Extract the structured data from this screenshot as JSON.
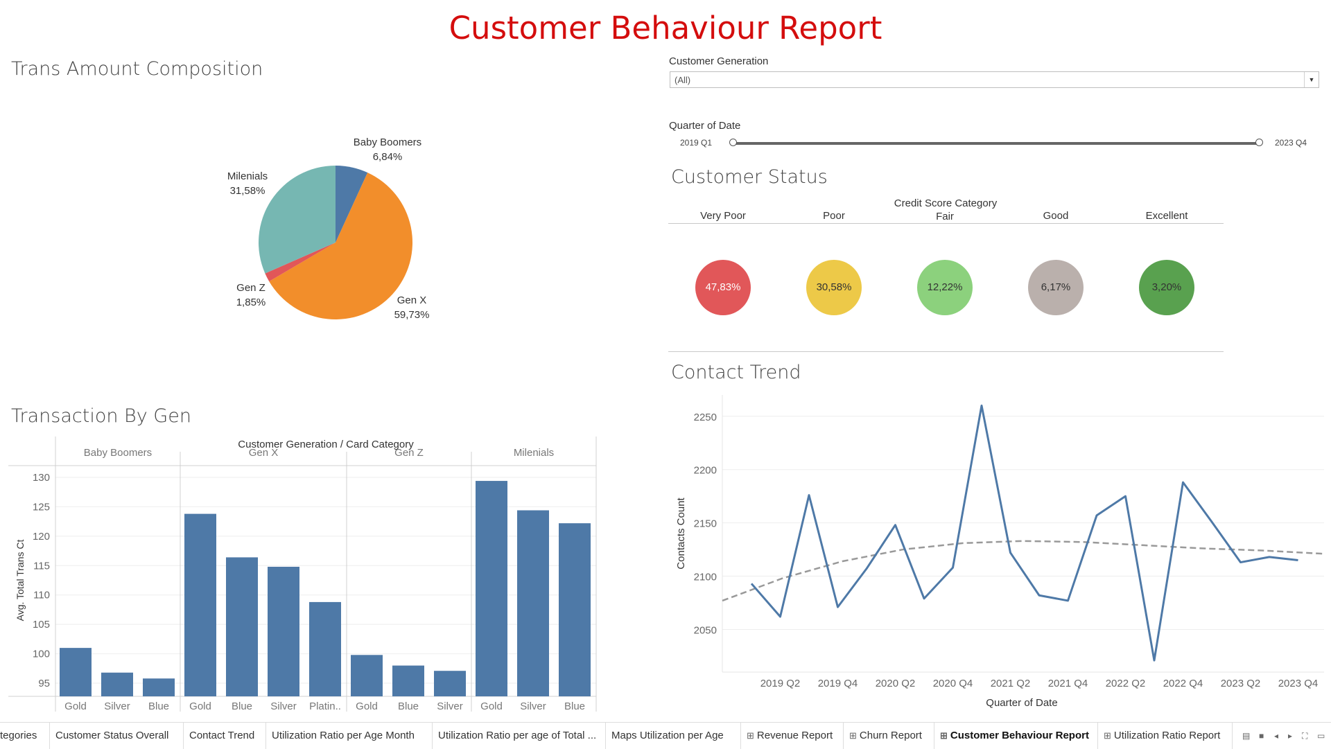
{
  "report_title": "Customer Behaviour Report",
  "pie_section": {
    "title": "Trans Amount Composition",
    "slices": [
      {
        "name": "Baby Boomers",
        "pct_label": "6,84%",
        "value": 6.84,
        "color": "#4e79a7"
      },
      {
        "name": "Gen X",
        "pct_label": "59,73%",
        "value": 59.73,
        "color": "#f28e2b"
      },
      {
        "name": "Gen Z",
        "pct_label": "1,85%",
        "value": 1.85,
        "color": "#e15759"
      },
      {
        "name": "Milenials",
        "pct_label": "31,58%",
        "value": 31.58,
        "color": "#76b7b2"
      }
    ]
  },
  "filters": {
    "generation_label": "Customer Generation",
    "generation_value": "(All)",
    "quarter_label": "Quarter of Date",
    "quarter_start": "2019 Q1",
    "quarter_end": "2023 Q4"
  },
  "customer_status": {
    "title": "Customer Status",
    "header_top": "Credit Score Category",
    "categories": [
      {
        "name": "Very Poor",
        "value": "47,83%",
        "color": "#e15759",
        "text_color": "#ffffff"
      },
      {
        "name": "Poor",
        "value": "30,58%",
        "color": "#edc948",
        "text_color": "#333333"
      },
      {
        "name": "Fair",
        "value": "12,22%",
        "color": "#8cd17d",
        "text_color": "#333333"
      },
      {
        "name": "Good",
        "value": "6,17%",
        "color": "#bab0ac",
        "text_color": "#333333"
      },
      {
        "name": "Excellent",
        "value": "3,20%",
        "color": "#59a14f",
        "text_color": "#333333"
      }
    ]
  },
  "bar_section": {
    "title": "Transaction By Gen",
    "header": "Customer Generation  /  Card Category",
    "y_axis_title": "Avg. Total Trans Ct",
    "y_ticks": [
      "95",
      "100",
      "105",
      "110",
      "115",
      "120",
      "125",
      "130"
    ]
  },
  "contact_section": {
    "title": "Contact Trend",
    "y_axis_title": "Contacts Count",
    "x_axis_title": "Quarter of Date",
    "y_ticks": [
      "2050",
      "2100",
      "2150",
      "2200",
      "2250"
    ],
    "x_ticks": [
      "2019 Q2",
      "2019 Q4",
      "2020 Q2",
      "2020 Q4",
      "2021 Q2",
      "2021 Q4",
      "2022 Q2",
      "2022 Q4",
      "2023 Q2",
      "2023 Q4"
    ]
  },
  "chart_data": [
    {
      "type": "pie",
      "title": "Trans Amount Composition",
      "categories": [
        "Baby Boomers",
        "Gen X",
        "Gen Z",
        "Milenials"
      ],
      "values": [
        6.84,
        59.73,
        1.85,
        31.58
      ]
    },
    {
      "type": "bar",
      "title": "Transaction By Gen",
      "ylabel": "Avg. Total Trans Ct",
      "xlabel": "Customer Generation  /  Card Category",
      "ylim": [
        93,
        132
      ],
      "groups": [
        {
          "name": "Baby Boomers",
          "categories": [
            "Gold",
            "Silver",
            "Blue"
          ],
          "values": [
            101.0,
            96.8,
            95.8
          ]
        },
        {
          "name": "Gen X",
          "categories": [
            "Gold",
            "Blue",
            "Silver",
            "Platin.."
          ],
          "values": [
            123.8,
            116.4,
            114.8,
            108.8
          ]
        },
        {
          "name": "Gen Z",
          "categories": [
            "Gold",
            "Blue",
            "Silver"
          ],
          "values": [
            99.8,
            98.0,
            97.1
          ]
        },
        {
          "name": "Milenials",
          "categories": [
            "Gold",
            "Silver",
            "Blue"
          ],
          "values": [
            129.4,
            124.4,
            122.2
          ]
        }
      ]
    },
    {
      "type": "line",
      "title": "Contact Trend",
      "xlabel": "Quarter of Date",
      "ylabel": "Contacts Count",
      "ylim": [
        2010,
        2270
      ],
      "x": [
        "2019 Q1",
        "2019 Q2",
        "2019 Q3",
        "2019 Q4",
        "2020 Q1",
        "2020 Q2",
        "2020 Q3",
        "2020 Q4",
        "2021 Q1",
        "2021 Q2",
        "2021 Q3",
        "2021 Q4",
        "2022 Q1",
        "2022 Q2",
        "2022 Q3",
        "2022 Q4",
        "2023 Q1",
        "2023 Q2",
        "2023 Q3",
        "2023 Q4"
      ],
      "series": [
        {
          "values": [
            2093,
            2062,
            2176,
            2071,
            2107,
            2148,
            2079,
            2108,
            2260,
            2122,
            2082,
            2077,
            2157,
            2175,
            2021,
            2188,
            2151,
            2113,
            2118,
            2115
          ]
        }
      ],
      "trend_line": {
        "style": "dashed",
        "x_range": [
          "2019 Q1",
          "2023 Q4"
        ],
        "values": [
          2077,
          2098,
          2114,
          2125,
          2131,
          2133,
          2132,
          2129,
          2126,
          2124,
          2121
        ]
      }
    }
  ],
  "tabs": [
    {
      "label": "tegories",
      "icon": ""
    },
    {
      "label": "Customer Status Overall",
      "icon": ""
    },
    {
      "label": "Contact Trend",
      "icon": ""
    },
    {
      "label": "Utilization Ratio per Age Month",
      "icon": ""
    },
    {
      "label": "Utilization Ratio per age of Total ...",
      "icon": ""
    },
    {
      "label": "Maps Utilization per Age",
      "icon": ""
    },
    {
      "label": "Revenue Report",
      "icon": "⊞"
    },
    {
      "label": "Churn Report",
      "icon": "⊞"
    },
    {
      "label": "Customer Behaviour Report",
      "icon": "⊞",
      "active": true
    },
    {
      "label": "Utilization Ratio Report",
      "icon": "⊞"
    }
  ]
}
